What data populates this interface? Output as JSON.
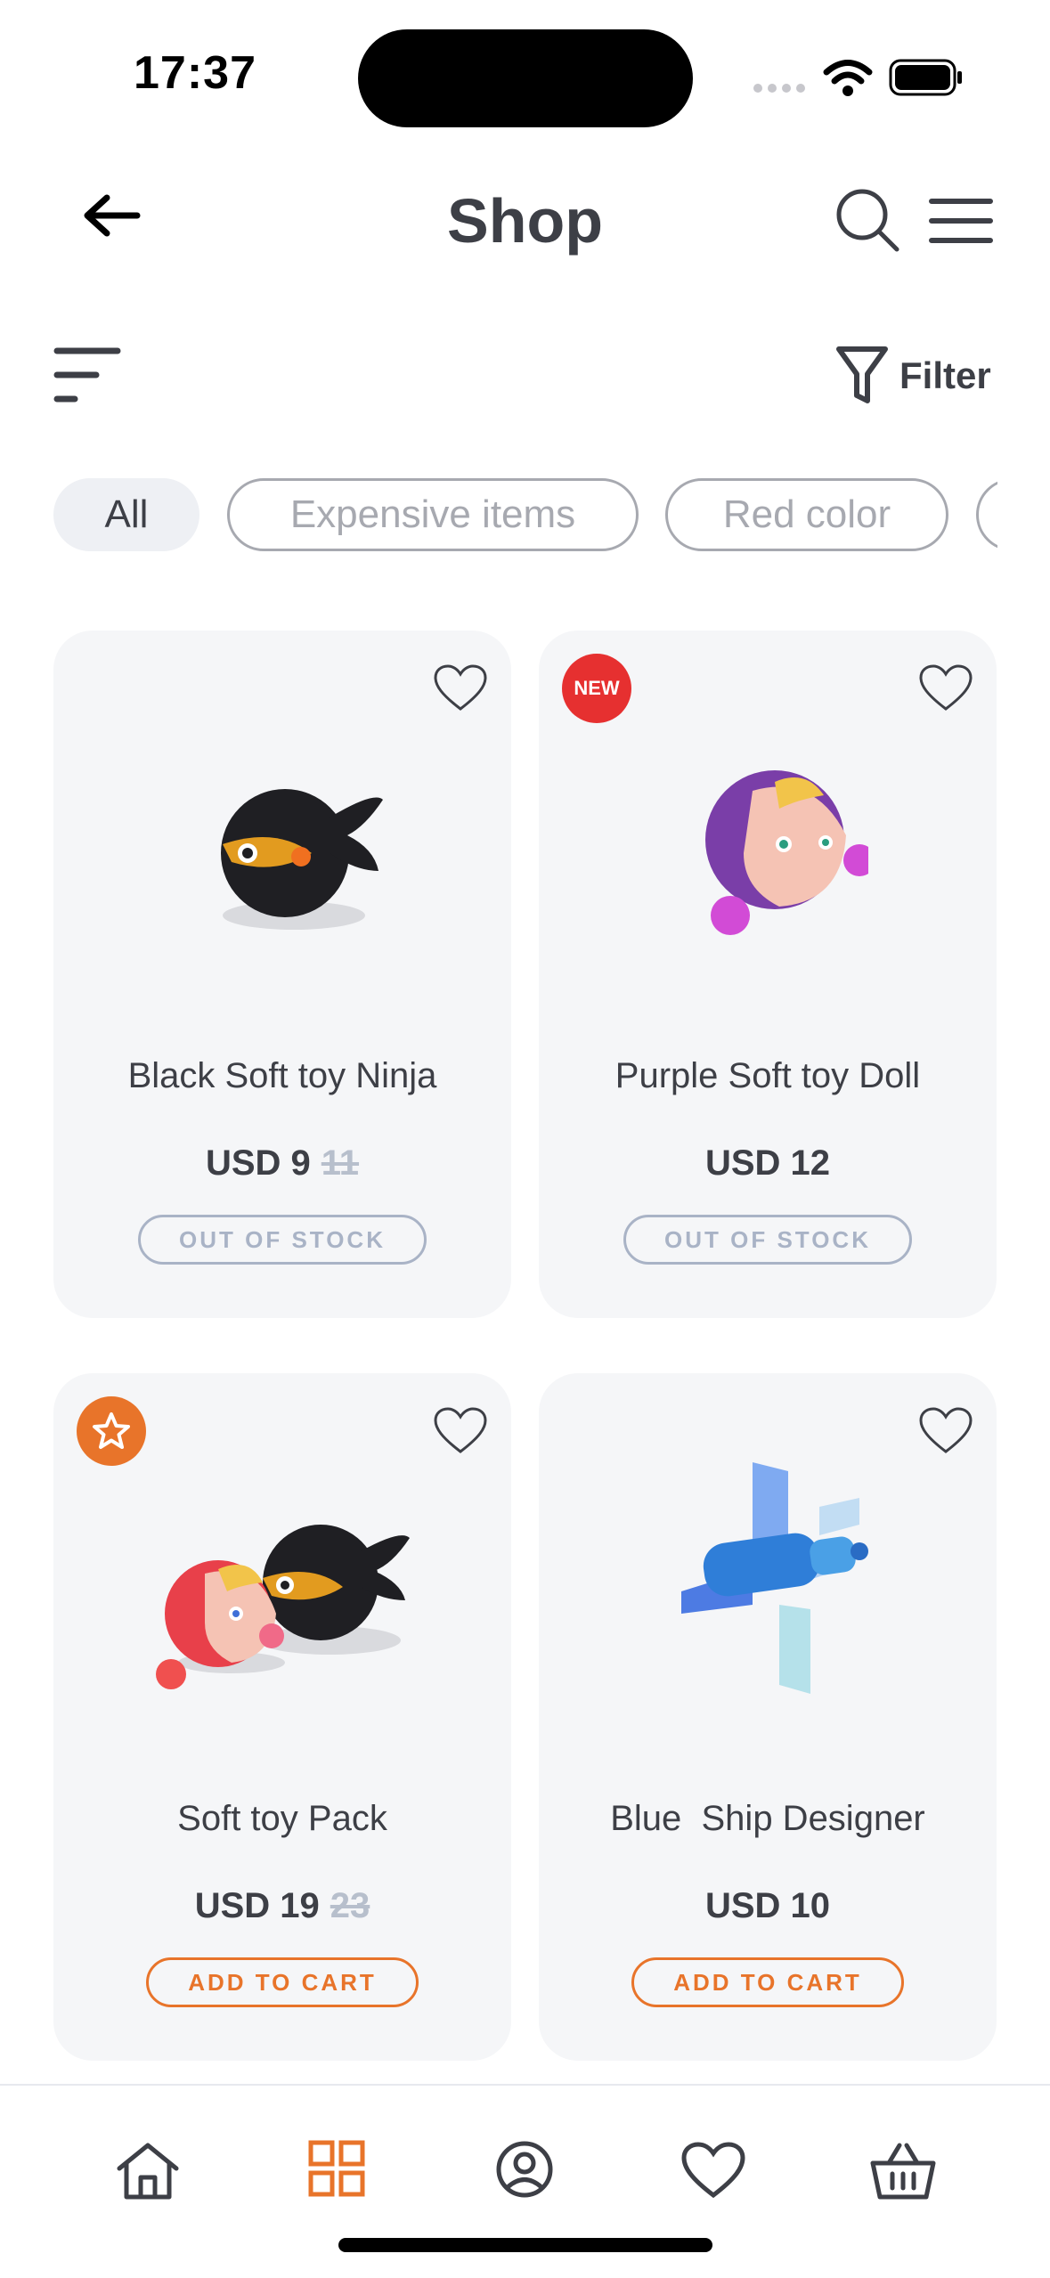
{
  "status_bar": {
    "time": "17:37"
  },
  "header": {
    "title": "Shop",
    "icons": [
      "back-arrow-icon",
      "search-icon",
      "menu-icon"
    ]
  },
  "toolbar": {
    "filter_label": "Filter",
    "icons": [
      "sort-icon",
      "filter-icon"
    ]
  },
  "chips": [
    {
      "label": "All",
      "active": true
    },
    {
      "label": "Expensive items",
      "active": false
    },
    {
      "label": "Red color",
      "active": false
    }
  ],
  "products": [
    {
      "name": "Black Soft toy Ninja",
      "price": "USD 9",
      "old_price": "11",
      "button": "OUT OF STOCK",
      "badge": "",
      "favorite_icon": "heart-icon"
    },
    {
      "name": "Purple Soft toy Doll",
      "price": "USD 12",
      "old_price": "",
      "button": "OUT OF STOCK",
      "badge": "NEW",
      "favorite_icon": "heart-icon"
    },
    {
      "name": "Soft toy Pack",
      "price": "USD 19",
      "old_price": "23",
      "button": "ADD TO CART",
      "badge": "star",
      "favorite_icon": "heart-icon"
    },
    {
      "name": "Blue  Ship Designer",
      "price": "USD 10",
      "old_price": "",
      "button": "ADD TO CART",
      "badge": "",
      "favorite_icon": "heart-icon"
    }
  ],
  "bottom_nav": [
    {
      "icon": "home-icon",
      "active": false
    },
    {
      "icon": "grid-icon",
      "active": true
    },
    {
      "icon": "profile-icon",
      "active": false
    },
    {
      "icon": "heart-icon",
      "active": false
    },
    {
      "icon": "basket-icon",
      "active": false
    }
  ],
  "colors": {
    "accent": "#e8742a",
    "badge_new": "#e63030",
    "text": "#3d3f46",
    "muted": "#a7a9b0",
    "card_bg": "#f5f6f8"
  }
}
